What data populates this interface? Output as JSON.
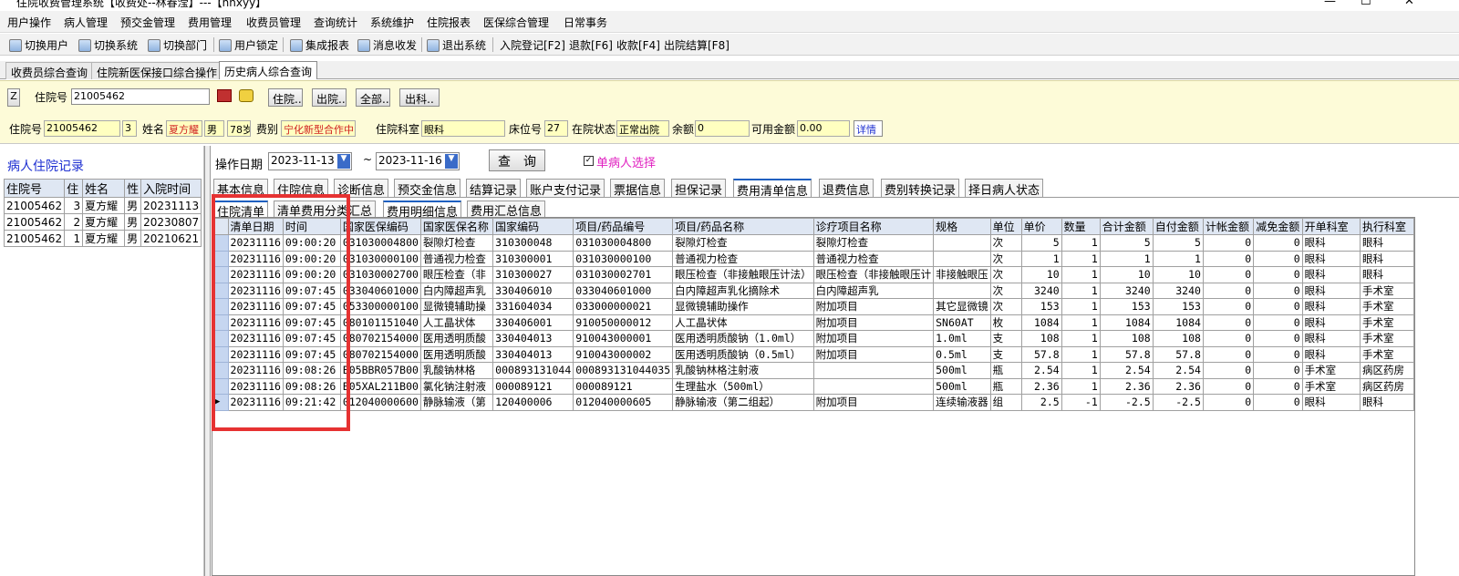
{
  "window": {
    "title": "住院收费管理系统【收费处--林春滢】---【nhxyy】"
  },
  "menu": [
    "用户操作",
    "病人管理",
    "预交金管理",
    "费用管理",
    "收费员管理",
    "查询统计",
    "系统维护",
    "住院报表",
    "医保综合管理",
    "日常事务"
  ],
  "toolbar": [
    "切换用户",
    "切换系统",
    "切换部门",
    "用户锁定",
    "集成报表",
    "消息收发",
    "退出系统",
    "入院登记[F2]",
    "退款[F6]",
    "收款[F4]",
    "出院结算[F8]"
  ],
  "tabs": [
    "收费员综合查询",
    "住院新医保接口综合操作",
    "历史病人综合查询"
  ],
  "search": {
    "z_button": "Z",
    "label": "住院号",
    "value": "21005462",
    "buttons": [
      "住院..",
      "出院..",
      "全部..",
      "出科.."
    ]
  },
  "patient": {
    "id_label": "住院号",
    "id": "21005462",
    "times": "3",
    "name_label": "姓名",
    "name": "夏方耀",
    "sex": "男",
    "age": "78岁",
    "fee_label": "费别",
    "fee": "宁化新型合作中",
    "dept_label": "住院科室",
    "dept": "眼科",
    "bed_label": "床位号",
    "bed": "27",
    "status_label": "在院状态",
    "status": "正常出院",
    "balance_label": "余额",
    "balance": "0",
    "avail_label": "可用金额",
    "avail": "0.00",
    "detail": "详情"
  },
  "left": {
    "title": "病人住院记录",
    "headers": [
      "住院号",
      "住",
      "姓名",
      "性",
      "入院时间"
    ],
    "rows": [
      [
        "21005462",
        "3",
        "夏方耀",
        "男",
        "20231113"
      ],
      [
        "21005462",
        "2",
        "夏方耀",
        "男",
        "20230807"
      ],
      [
        "21005462",
        "1",
        "夏方耀",
        "男",
        "20210621"
      ]
    ]
  },
  "filter": {
    "date_label": "操作日期",
    "from": "2023-11-13",
    "tilde": "~",
    "to": "2023-11-16",
    "query": "查　询",
    "single_label": "单病人选择"
  },
  "tabs2": [
    "基本信息",
    "住院信息",
    "诊断信息",
    "预交金信息",
    "结算记录",
    "账户支付记录",
    "票据信息",
    "担保记录",
    "费用清单信息",
    "退费信息",
    "费别转换记录",
    "择日病人状态"
  ],
  "tabs3": [
    "住院清单",
    "清单费用分类汇总",
    "费用明细信息",
    "费用汇总信息"
  ],
  "grid": {
    "headers": [
      "清单日期",
      "时间",
      "国家医保编码",
      "国家医保名称",
      "国家编码",
      "项目/药品编号",
      "项目/药品名称",
      "诊疗项目名称",
      "规格",
      "单位",
      "单价",
      "数量",
      "合计金额",
      "自付金额",
      "计帐金额",
      "减免金额",
      "开单科室",
      "执行科室"
    ],
    "rows": [
      [
        "20231116",
        "09:00:20",
        "031030004800",
        "裂隙灯检查",
        "310300048",
        "031030004800",
        "裂隙灯检查",
        "裂隙灯检查",
        "",
        "次",
        "5",
        "1",
        "5",
        "5",
        "0",
        "0",
        "眼科",
        "眼科"
      ],
      [
        "20231116",
        "09:00:20",
        "031030000100",
        "普通视力检查",
        "310300001",
        "031030000100",
        "普通视力检查",
        "普通视力检查",
        "",
        "次",
        "1",
        "1",
        "1",
        "1",
        "0",
        "0",
        "眼科",
        "眼科"
      ],
      [
        "20231116",
        "09:00:20",
        "031030002700",
        "眼压检查（非",
        "310300027",
        "031030002701",
        "眼压检查（非接触眼压计法）",
        "眼压检查（非接触眼压计",
        "非接触眼压",
        "次",
        "10",
        "1",
        "10",
        "10",
        "0",
        "0",
        "眼科",
        "眼科"
      ],
      [
        "20231116",
        "09:07:45",
        "033040601000",
        "白内障超声乳",
        "330406010",
        "033040601000",
        "白内障超声乳化摘除术",
        "白内障超声乳",
        "",
        "次",
        "3240",
        "1",
        "3240",
        "3240",
        "0",
        "0",
        "眼科",
        "手术室"
      ],
      [
        "20231116",
        "09:07:45",
        "053300000100",
        "显微镜辅助操",
        "331604034",
        "033000000021",
        "显微镜辅助操作",
        "附加项目",
        "其它显微镜",
        "次",
        "153",
        "1",
        "153",
        "153",
        "0",
        "0",
        "眼科",
        "手术室"
      ],
      [
        "20231116",
        "09:07:45",
        "080101151040",
        "人工晶状体",
        "330406001",
        "910050000012",
        "人工晶状体",
        "附加项目",
        "SN60AT",
        "枚",
        "1084",
        "1",
        "1084",
        "1084",
        "0",
        "0",
        "眼科",
        "手术室"
      ],
      [
        "20231116",
        "09:07:45",
        "080702154000",
        "医用透明质酸",
        "330404013",
        "910043000001",
        "医用透明质酸钠（1.0ml）",
        "附加项目",
        "1.0ml",
        "支",
        "108",
        "1",
        "108",
        "108",
        "0",
        "0",
        "眼科",
        "手术室"
      ],
      [
        "20231116",
        "09:07:45",
        "080702154000",
        "医用透明质酸",
        "330404013",
        "910043000002",
        "医用透明质酸钠（0.5ml）",
        "附加项目",
        "0.5ml",
        "支",
        "57.8",
        "1",
        "57.8",
        "57.8",
        "0",
        "0",
        "眼科",
        "手术室"
      ],
      [
        "20231116",
        "09:08:26",
        "B05BBR057B00",
        "乳酸钠林格",
        "000893131044",
        "000893131044035",
        "乳酸钠林格注射液",
        "",
        "500ml",
        "瓶",
        "2.54",
        "1",
        "2.54",
        "2.54",
        "0",
        "0",
        "手术室",
        "病区药房"
      ],
      [
        "20231116",
        "09:08:26",
        "B05XAL211B00",
        "氯化钠注射液",
        "000089121",
        "000089121",
        "生理盐水（500ml）",
        "",
        "500ml",
        "瓶",
        "2.36",
        "1",
        "2.36",
        "2.36",
        "0",
        "0",
        "手术室",
        "病区药房"
      ],
      [
        "20231116",
        "09:21:42",
        "012040000600",
        "静脉输液（第",
        "120400006",
        "012040000605",
        "静脉输液（第二组起）",
        "附加项目",
        "连续输液器",
        "组",
        "2.5",
        "-1",
        "-2.5",
        "-2.5",
        "0",
        "0",
        "眼科",
        "眼科"
      ]
    ]
  }
}
